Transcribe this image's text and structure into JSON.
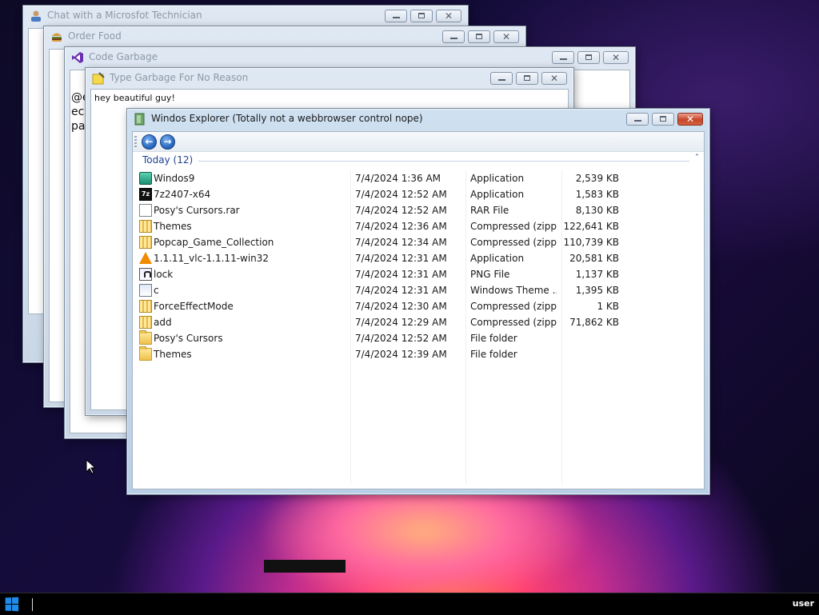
{
  "windows": {
    "chat": {
      "title": "Chat with a Microsfot Technician",
      "body_fragments": [
        "@e",
        "ec",
        "pa"
      ]
    },
    "food": {
      "title": "Order Food"
    },
    "code": {
      "title": "Code Garbage"
    },
    "type": {
      "title": "Type Garbage For No Reason",
      "text": "hey beautiful guy!"
    },
    "explorer": {
      "title": "Windos Explorer (Totally not a webbrowser control nope)",
      "back_label": "←",
      "forward_label": "→",
      "group": "Today (12)",
      "collapse_glyph": "˄",
      "files": [
        {
          "name": "Windos9",
          "date": "7/4/2024 1:36 AM",
          "type": "Application",
          "size": "2,539 KB",
          "icon": "app-icon"
        },
        {
          "name": "7z2407-x64",
          "date": "7/4/2024 12:52 AM",
          "type": "Application",
          "size": "1,583 KB",
          "icon": "7zip-icon"
        },
        {
          "name": "Posy's Cursors.rar",
          "date": "7/4/2024 12:52 AM",
          "type": "RAR File",
          "size": "8,130 KB",
          "icon": "file-icon"
        },
        {
          "name": "Themes",
          "date": "7/4/2024 12:36 AM",
          "type": "Compressed (zipp...",
          "size": "122,641 KB",
          "icon": "zip-folder-icon"
        },
        {
          "name": "Popcap_Game_Collection",
          "date": "7/4/2024 12:34 AM",
          "type": "Compressed (zipp...",
          "size": "110,739 KB",
          "icon": "zip-folder-icon"
        },
        {
          "name": "1.1.11_vlc-1.1.11-win32",
          "date": "7/4/2024 12:31 AM",
          "type": "Application",
          "size": "20,581 KB",
          "icon": "vlc-icon"
        },
        {
          "name": "lock",
          "date": "7/4/2024 12:31 AM",
          "type": "PNG File",
          "size": "1,137 KB",
          "icon": "png-icon"
        },
        {
          "name": "c",
          "date": "7/4/2024 12:31 AM",
          "type": "Windows Theme ...",
          "size": "1,395 KB",
          "icon": "theme-icon"
        },
        {
          "name": "ForceEffectMode",
          "date": "7/4/2024 12:30 AM",
          "type": "Compressed (zipp...",
          "size": "1 KB",
          "icon": "zip-folder-icon"
        },
        {
          "name": "add",
          "date": "7/4/2024 12:29 AM",
          "type": "Compressed (zipp...",
          "size": "71,862 KB",
          "icon": "zip-folder-icon"
        },
        {
          "name": "Posy's Cursors",
          "date": "7/4/2024 12:52 AM",
          "type": "File folder",
          "size": "",
          "icon": "folder-icon"
        },
        {
          "name": "Themes",
          "date": "7/4/2024 12:39 AM",
          "type": "File folder",
          "size": "",
          "icon": "folder-icon"
        }
      ]
    }
  },
  "caption_glyphs": {
    "close": "✕"
  },
  "taskbar": {
    "user": "user"
  },
  "colors": {
    "accent": "#1e3f92",
    "close_button": "#c6452a",
    "start_logo": "#1e8ce8"
  }
}
